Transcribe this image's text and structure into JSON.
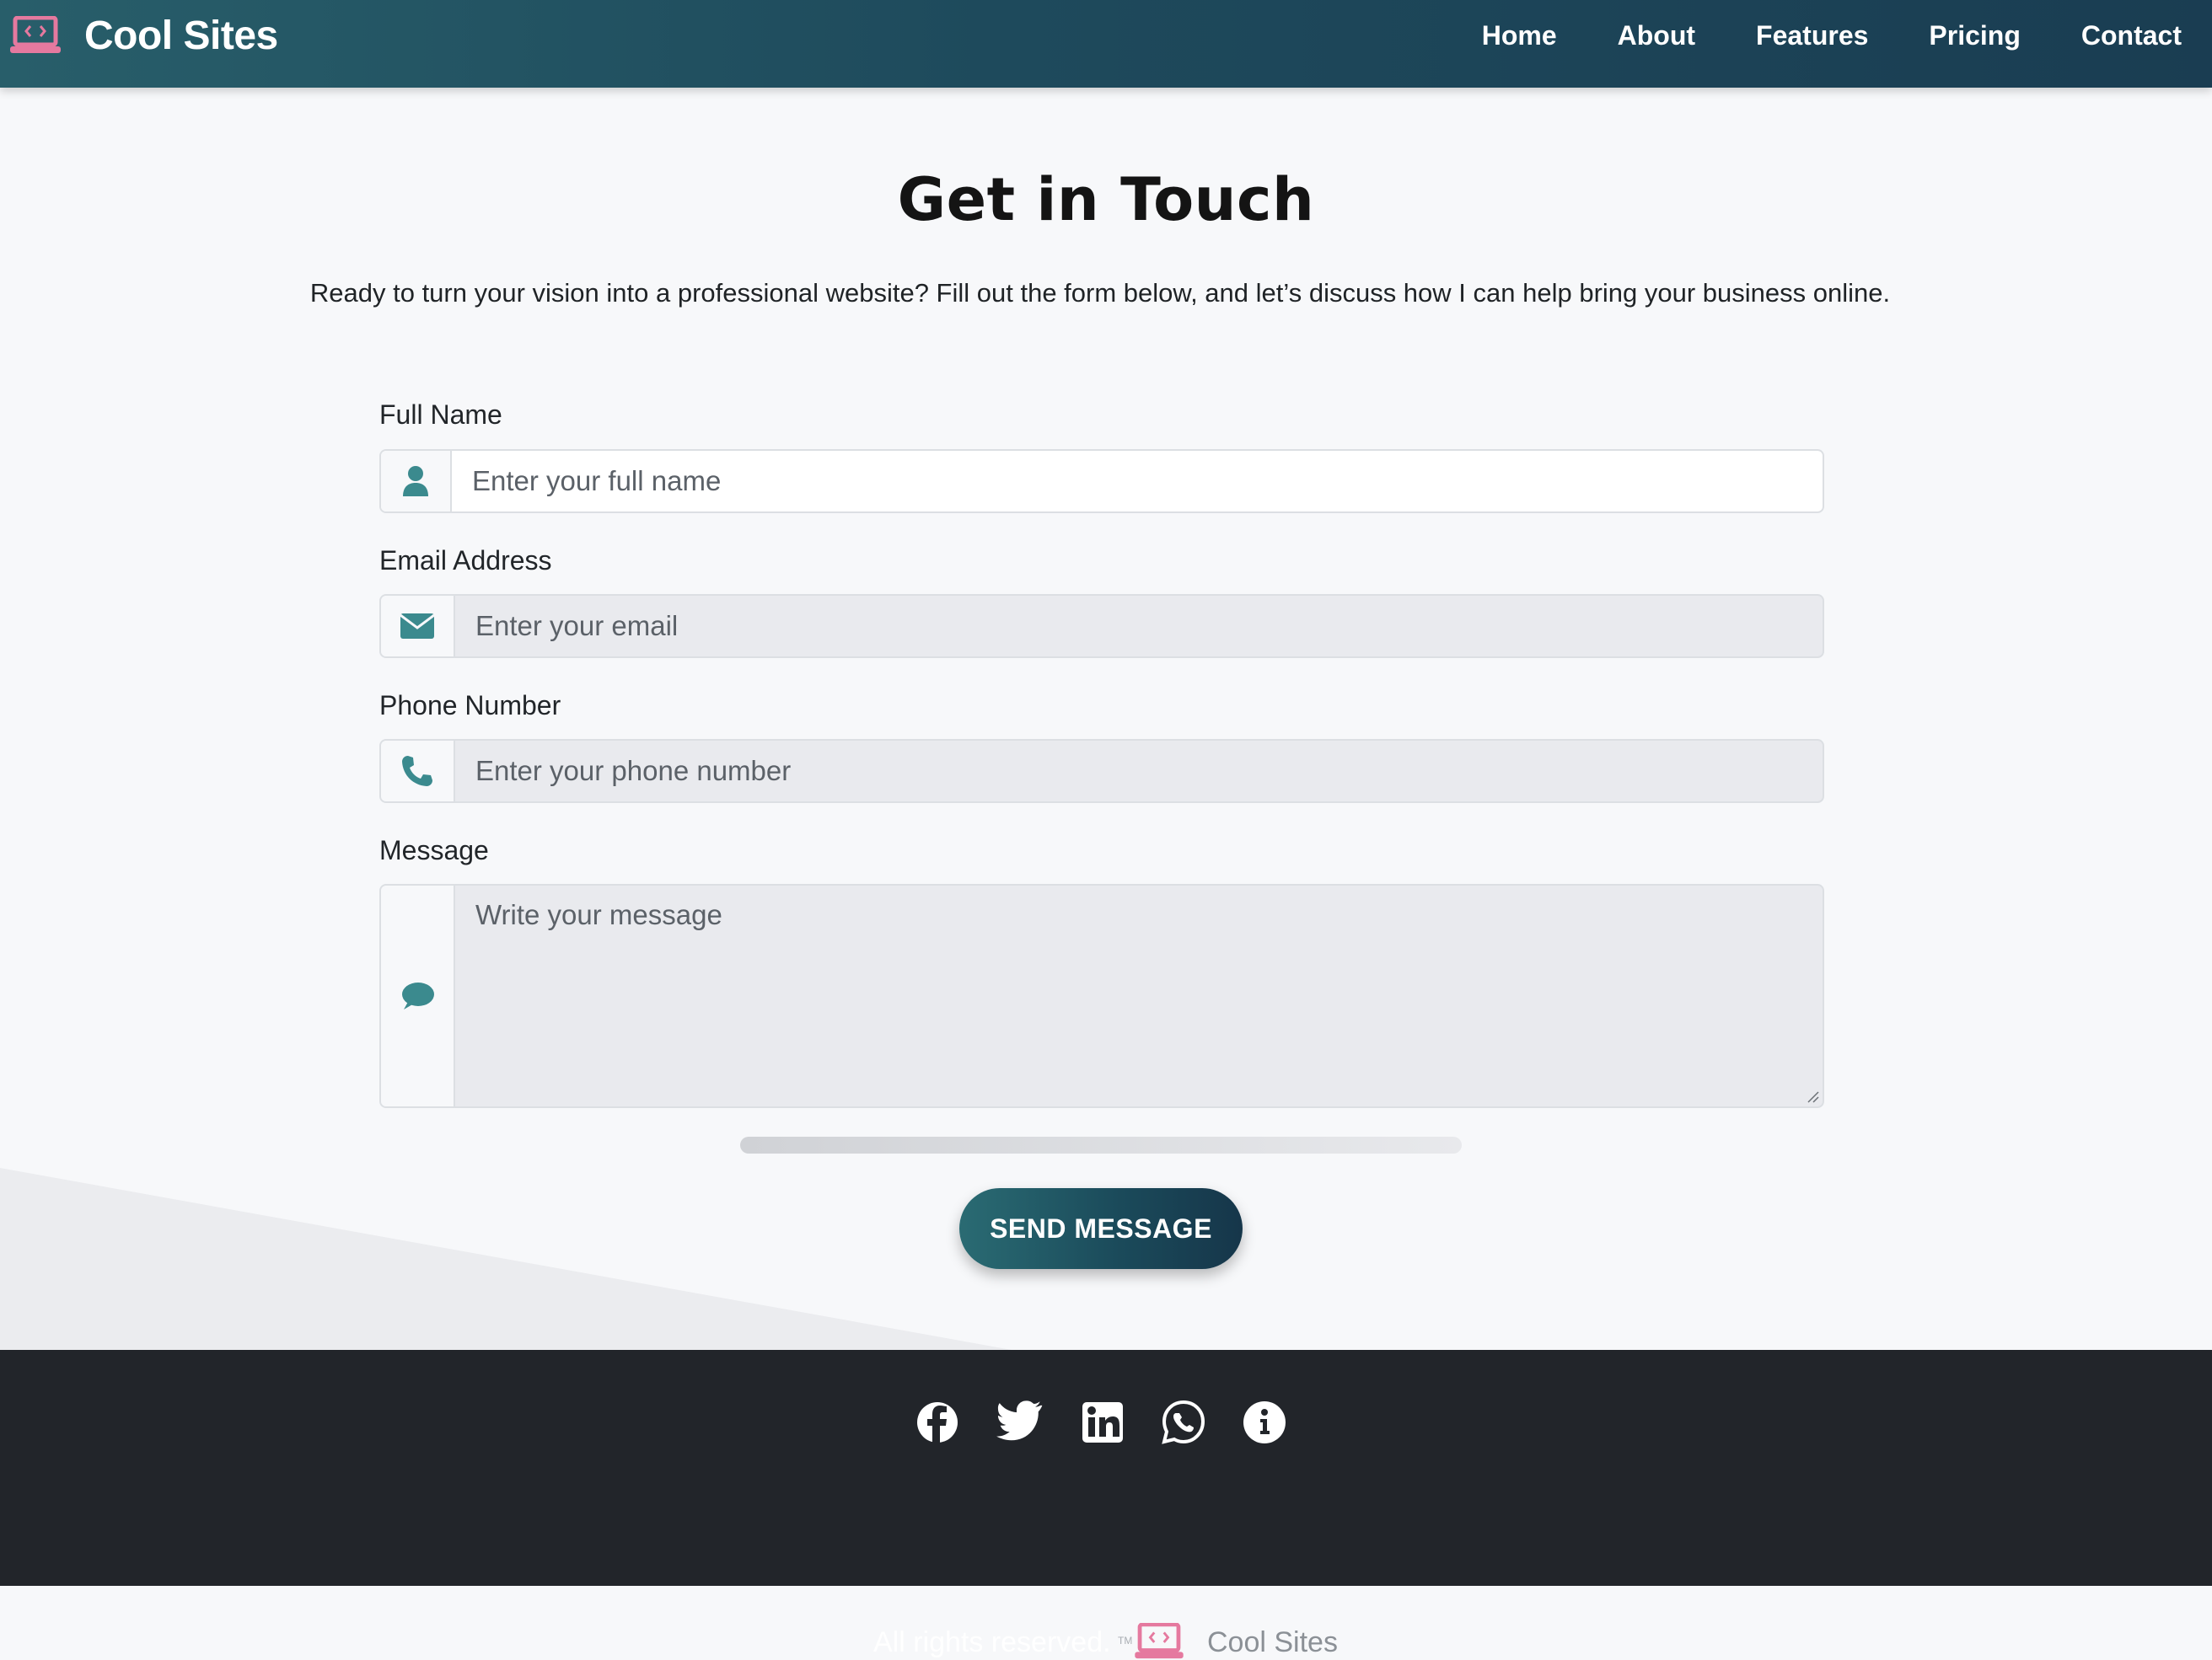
{
  "navbar": {
    "brand": "Cool Sites",
    "links": [
      "Home",
      "About",
      "Features",
      "Pricing",
      "Contact"
    ]
  },
  "hero": {
    "title": "Get in Touch",
    "subtitle": "Ready to turn your vision into a professional website? Fill out the form below, and let’s discuss how I can help bring your business online."
  },
  "form": {
    "name": {
      "label": "Full Name",
      "placeholder": "Enter your full name",
      "icon": "user-icon"
    },
    "email": {
      "label": "Email Address",
      "placeholder": "Enter your email",
      "icon": "envelope-icon"
    },
    "phone": {
      "label": "Phone Number",
      "placeholder": "Enter your phone number",
      "icon": "phone-icon"
    },
    "message": {
      "label": "Message",
      "placeholder": "Write your message",
      "icon": "comment-icon"
    },
    "progress": 0.0,
    "submit_label": "SEND MESSAGE"
  },
  "footer": {
    "social_icons": [
      "facebook-icon",
      "twitter-icon",
      "linkedin-icon",
      "whatsapp-icon",
      "info-icon"
    ],
    "rights": "All rights reserved.",
    "tm": "TM",
    "brand": "Cool Sites"
  },
  "colors": {
    "accent_teal": "#2a6b73",
    "navbar_dark": "#1a3d52",
    "logo_pink": "#e5799f",
    "footer_bg": "#22252a"
  }
}
